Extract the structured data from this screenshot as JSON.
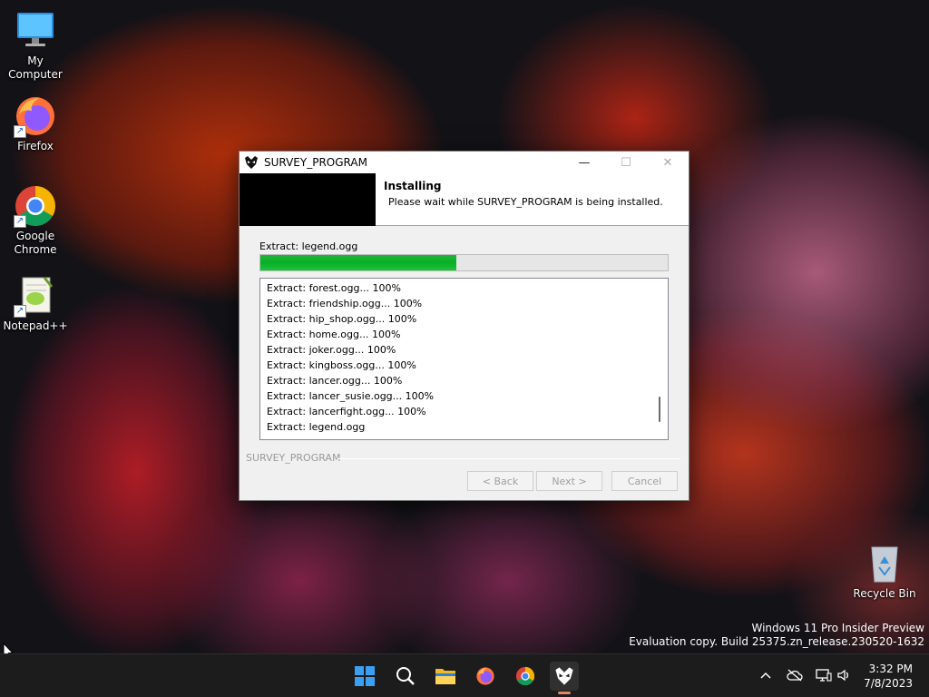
{
  "desktop": {
    "icons": [
      {
        "label": "My Computer",
        "icon": "computer-icon"
      },
      {
        "label": "Firefox",
        "icon": "firefox-icon"
      },
      {
        "label": "Google Chrome",
        "icon": "chrome-icon"
      },
      {
        "label": "Notepad++",
        "icon": "notepadpp-icon"
      },
      {
        "label": "Recycle Bin",
        "icon": "recycle-bin-icon"
      }
    ],
    "watermark": {
      "line1": "Windows 11 Pro Insider Preview",
      "line2": "Evaluation copy. Build 25375.zn_release.230520-1632"
    }
  },
  "installer": {
    "title": "SURVEY_PROGRAM",
    "header_title": "Installing",
    "header_subtitle": "Please wait while SURVEY_PROGRAM is being installed.",
    "status": "Extract: legend.ogg",
    "progress_fraction": 0.48,
    "log": [
      "Extract: forest.ogg... 100%",
      "Extract: friendship.ogg... 100%",
      "Extract: hip_shop.ogg... 100%",
      "Extract: home.ogg... 100%",
      "Extract: joker.ogg... 100%",
      "Extract: kingboss.ogg... 100%",
      "Extract: lancer.ogg... 100%",
      "Extract: lancer_susie.ogg... 100%",
      "Extract: lancerfight.ogg... 100%",
      "Extract: legend.ogg"
    ],
    "brand": "SURVEY_PROGRAM",
    "buttons": {
      "back": "< Back",
      "next": "Next >",
      "cancel": "Cancel"
    },
    "colors": {
      "progress": "#06b025"
    }
  },
  "taskbar": {
    "apps": [
      "start-icon",
      "search-icon",
      "file-explorer-icon",
      "firefox-icon",
      "chrome-icon",
      "survey-program-icon"
    ],
    "tray": [
      "chevron-up-icon",
      "cloud-icon",
      "network-icon",
      "volume-icon"
    ],
    "time": "3:32 PM",
    "date": "7/8/2023"
  }
}
